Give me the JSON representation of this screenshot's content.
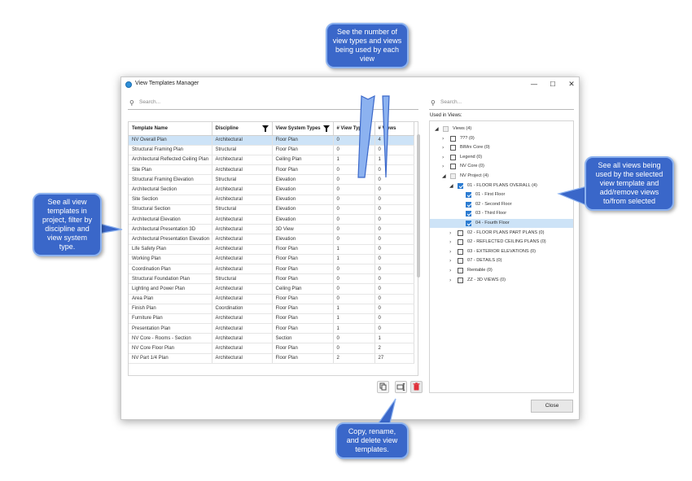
{
  "window": {
    "title": "View Templates Manager",
    "minimize": "—",
    "maximize": "☐",
    "close": "✕"
  },
  "left_search": {
    "placeholder": "Search...",
    "value": ""
  },
  "right_search": {
    "placeholder": "Search...",
    "value": ""
  },
  "table": {
    "headers": [
      "Template Name",
      "Discipline",
      "View System Types",
      "# View Types",
      "# Views"
    ],
    "rows": [
      [
        "NV Overall Plan",
        "Architectural",
        "Floor Plan",
        "0",
        "4"
      ],
      [
        "Structural Framing Plan",
        "Structural",
        "Floor Plan",
        "0",
        "0"
      ],
      [
        "Architectural Reflected Ceiling Plan",
        "Architectural",
        "Ceiling Plan",
        "1",
        "1"
      ],
      [
        "Site Plan",
        "Architectural",
        "Floor Plan",
        "0",
        "0"
      ],
      [
        "Structural Framing Elevation",
        "Structural",
        "Elevation",
        "0",
        "0"
      ],
      [
        "Architectural Section",
        "Architectural",
        "Elevation",
        "0",
        "0"
      ],
      [
        "Site Section",
        "Architectural",
        "Elevation",
        "0",
        "0"
      ],
      [
        "Structural Section",
        "Structural",
        "Elevation",
        "0",
        "0"
      ],
      [
        "Architectural Elevation",
        "Architectural",
        "Elevation",
        "0",
        "0"
      ],
      [
        "Architectural Presentation 3D",
        "Architectural",
        "3D View",
        "0",
        "0"
      ],
      [
        "Architectural Presentation Elevation",
        "Architectural",
        "Elevation",
        "0",
        "0"
      ],
      [
        "Life Safety Plan",
        "Architectural",
        "Floor Plan",
        "1",
        "0"
      ],
      [
        "Working Plan",
        "Architectural",
        "Floor Plan",
        "1",
        "0"
      ],
      [
        "Coordination Plan",
        "Architectural",
        "Floor Plan",
        "0",
        "0"
      ],
      [
        "Structural Foundation Plan",
        "Structural",
        "Floor Plan",
        "0",
        "0"
      ],
      [
        "Lighting and Power Plan",
        "Architectural",
        "Ceiling Plan",
        "0",
        "0"
      ],
      [
        "Area Plan",
        "Architectural",
        "Floor Plan",
        "0",
        "0"
      ],
      [
        "Finish Plan",
        "Coordination",
        "Floor Plan",
        "1",
        "0"
      ],
      [
        "Furniture Plan",
        "Architectural",
        "Floor Plan",
        "1",
        "0"
      ],
      [
        "Presentation Plan",
        "Architectural",
        "Floor Plan",
        "1",
        "0"
      ],
      [
        "NV Core - Rooms - Section",
        "Architectural",
        "Section",
        "0",
        "1"
      ],
      [
        "NV Core Floor Plan",
        "Architectural",
        "Floor Plan",
        "0",
        "2"
      ],
      [
        "NV Part 1/4 Plan",
        "Architectural",
        "Floor Plan",
        "2",
        "27"
      ]
    ]
  },
  "used_in_views": {
    "label": "Used in Views:",
    "items": [
      {
        "label": "Views (4)",
        "level": 0,
        "arrow": "◢",
        "check": "disabled"
      },
      {
        "label": "??? (0)",
        "level": 1,
        "arrow": "›",
        "check": "none"
      },
      {
        "label": "BIMrx Core (0)",
        "level": 1,
        "arrow": "›",
        "check": "none"
      },
      {
        "label": "Legend (0)",
        "level": 1,
        "arrow": "›",
        "check": "none"
      },
      {
        "label": "NV Core (0)",
        "level": 1,
        "arrow": "›",
        "check": "none"
      },
      {
        "label": "NV Project (4)",
        "level": 1,
        "arrow": "◢",
        "check": "disabled"
      },
      {
        "label": "01 - FLOOR PLANS OVERALL (4)",
        "level": 2,
        "arrow": "◢",
        "check": "checked"
      },
      {
        "label": "01 - First Floor",
        "level": 3,
        "arrow": "",
        "check": "checked"
      },
      {
        "label": "02 - Second Floor",
        "level": 3,
        "arrow": "",
        "check": "checked"
      },
      {
        "label": "03 - Third Floor",
        "level": 3,
        "arrow": "",
        "check": "checked"
      },
      {
        "label": "04 - Fourth Floor",
        "level": 3,
        "arrow": "",
        "check": "checked",
        "selected": true
      },
      {
        "label": "02 - FLOOR PLANS PART PLANS (0)",
        "level": 2,
        "arrow": "›",
        "check": "none"
      },
      {
        "label": "02 - REFLECTED CEILING PLANS (0)",
        "level": 2,
        "arrow": "›",
        "check": "none"
      },
      {
        "label": "03 - EXTERIOR ELEVATIONS (0)",
        "level": 2,
        "arrow": "›",
        "check": "none"
      },
      {
        "label": "07 - DETAILS (0)",
        "level": 2,
        "arrow": "›",
        "check": "none"
      },
      {
        "label": "Rentable (0)",
        "level": 2,
        "arrow": "›",
        "check": "none"
      },
      {
        "label": "ZZ - 3D VIEWS (0)",
        "level": 2,
        "arrow": "›",
        "check": "none"
      }
    ]
  },
  "buttons": {
    "close": "Close"
  },
  "icons": {
    "search": "search-icon",
    "copy": "copy-icon",
    "rename": "rename-icon",
    "delete": "trash-icon",
    "filter": "filter-icon"
  },
  "colors": {
    "selection": "#cde3f7",
    "callout": "#3a67c9",
    "delete": "#e0303a",
    "checkbox": "#2b7bd1"
  },
  "callouts": {
    "top": "See the number of view types and views being used by each view",
    "left": "See all view templates in project, filter by discipline and view system type.",
    "right": "See all views being used by the selected view template and add/remove views to/from selected",
    "bottom": "Copy, rename, and delete view templates."
  }
}
